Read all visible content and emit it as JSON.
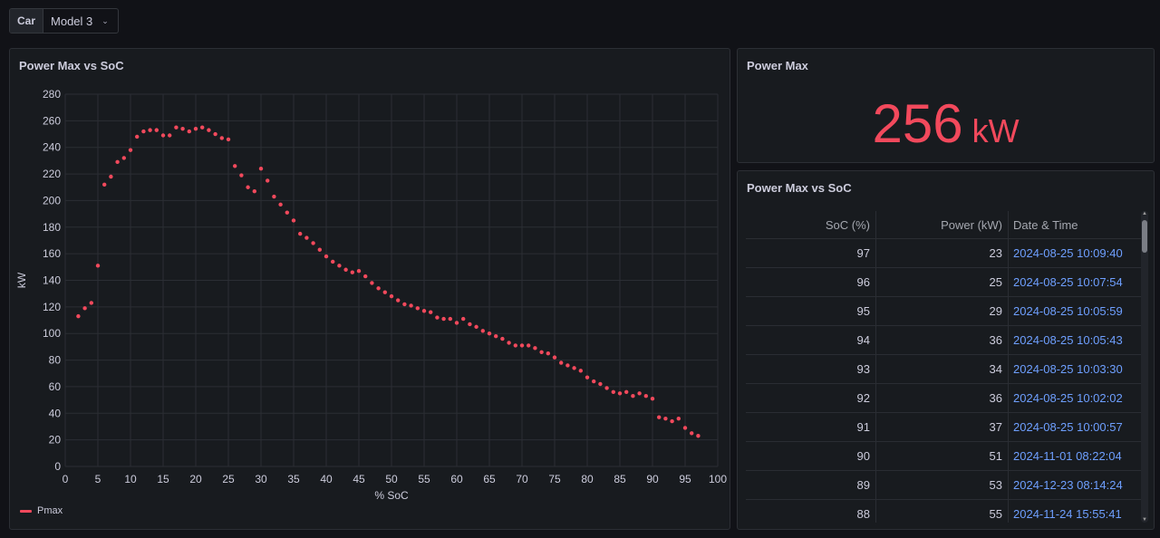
{
  "variable": {
    "label": "Car",
    "value": "Model 3"
  },
  "chart_panel": {
    "title": "Power Max vs SoC",
    "legend": "Pmax"
  },
  "stat_panel": {
    "title": "Power Max",
    "value": "256",
    "unit": "kW"
  },
  "table_panel": {
    "title": "Power Max vs SoC",
    "headers": [
      "SoC (%)",
      "Power (kW)",
      "Date & Time"
    ],
    "rows": [
      [
        "97",
        "23",
        "2024-08-25 10:09:40"
      ],
      [
        "96",
        "25",
        "2024-08-25 10:07:54"
      ],
      [
        "95",
        "29",
        "2024-08-25 10:05:59"
      ],
      [
        "94",
        "36",
        "2024-08-25 10:05:43"
      ],
      [
        "93",
        "34",
        "2024-08-25 10:03:30"
      ],
      [
        "92",
        "36",
        "2024-08-25 10:02:02"
      ],
      [
        "91",
        "37",
        "2024-08-25 10:00:57"
      ],
      [
        "90",
        "51",
        "2024-11-01 08:22:04"
      ],
      [
        "89",
        "53",
        "2024-12-23 08:14:24"
      ],
      [
        "88",
        "55",
        "2024-11-24 15:55:41"
      ]
    ]
  },
  "colors": {
    "series": "#f2495c",
    "link": "#6e9fff",
    "background": "#111217",
    "panel": "#181b1f"
  },
  "chart_data": {
    "type": "scatter",
    "xlabel": "% SoC",
    "ylabel": "kW",
    "xlim": [
      0,
      100
    ],
    "ylim": [
      0,
      280
    ],
    "x_ticks": [
      0,
      5,
      10,
      15,
      20,
      25,
      30,
      35,
      40,
      45,
      50,
      55,
      60,
      65,
      70,
      75,
      80,
      85,
      90,
      95,
      100
    ],
    "y_ticks": [
      0,
      20,
      40,
      60,
      80,
      100,
      120,
      140,
      160,
      180,
      200,
      220,
      240,
      260,
      280
    ],
    "grid": true,
    "legend_position": "bottom-left",
    "series": [
      {
        "name": "Pmax",
        "points": [
          [
            2,
            113
          ],
          [
            3,
            119
          ],
          [
            4,
            123
          ],
          [
            5,
            151
          ],
          [
            6,
            212
          ],
          [
            7,
            218
          ],
          [
            8,
            229
          ],
          [
            9,
            232
          ],
          [
            10,
            238
          ],
          [
            11,
            248
          ],
          [
            12,
            252
          ],
          [
            13,
            253
          ],
          [
            14,
            253
          ],
          [
            15,
            249
          ],
          [
            16,
            249
          ],
          [
            17,
            255
          ],
          [
            18,
            254
          ],
          [
            19,
            252
          ],
          [
            20,
            254
          ],
          [
            21,
            255
          ],
          [
            22,
            253
          ],
          [
            23,
            250
          ],
          [
            24,
            247
          ],
          [
            25,
            246
          ],
          [
            26,
            226
          ],
          [
            27,
            219
          ],
          [
            28,
            210
          ],
          [
            29,
            207
          ],
          [
            30,
            224
          ],
          [
            31,
            215
          ],
          [
            32,
            203
          ],
          [
            33,
            197
          ],
          [
            34,
            191
          ],
          [
            35,
            185
          ],
          [
            36,
            175
          ],
          [
            37,
            172
          ],
          [
            38,
            168
          ],
          [
            39,
            163
          ],
          [
            40,
            158
          ],
          [
            41,
            154
          ],
          [
            42,
            151
          ],
          [
            43,
            148
          ],
          [
            44,
            146
          ],
          [
            45,
            147
          ],
          [
            46,
            143
          ],
          [
            47,
            138
          ],
          [
            48,
            134
          ],
          [
            49,
            131
          ],
          [
            50,
            128
          ],
          [
            51,
            125
          ],
          [
            52,
            122
          ],
          [
            53,
            121
          ],
          [
            54,
            119
          ],
          [
            55,
            117
          ],
          [
            56,
            116
          ],
          [
            57,
            112
          ],
          [
            58,
            111
          ],
          [
            59,
            111
          ],
          [
            60,
            108
          ],
          [
            61,
            111
          ],
          [
            62,
            107
          ],
          [
            63,
            105
          ],
          [
            64,
            102
          ],
          [
            65,
            100
          ],
          [
            66,
            98
          ],
          [
            67,
            96
          ],
          [
            68,
            93
          ],
          [
            69,
            91
          ],
          [
            70,
            91
          ],
          [
            71,
            91
          ],
          [
            72,
            89
          ],
          [
            73,
            86
          ],
          [
            74,
            85
          ],
          [
            75,
            82
          ],
          [
            76,
            78
          ],
          [
            77,
            76
          ],
          [
            78,
            74
          ],
          [
            79,
            72
          ],
          [
            80,
            67
          ],
          [
            81,
            64
          ],
          [
            82,
            62
          ],
          [
            83,
            59
          ],
          [
            84,
            56
          ],
          [
            85,
            55
          ],
          [
            86,
            56
          ],
          [
            87,
            53
          ],
          [
            88,
            55
          ],
          [
            89,
            53
          ],
          [
            90,
            51
          ],
          [
            91,
            37
          ],
          [
            92,
            36
          ],
          [
            93,
            34
          ],
          [
            94,
            36
          ],
          [
            95,
            29
          ],
          [
            96,
            25
          ],
          [
            97,
            23
          ]
        ]
      }
    ]
  }
}
